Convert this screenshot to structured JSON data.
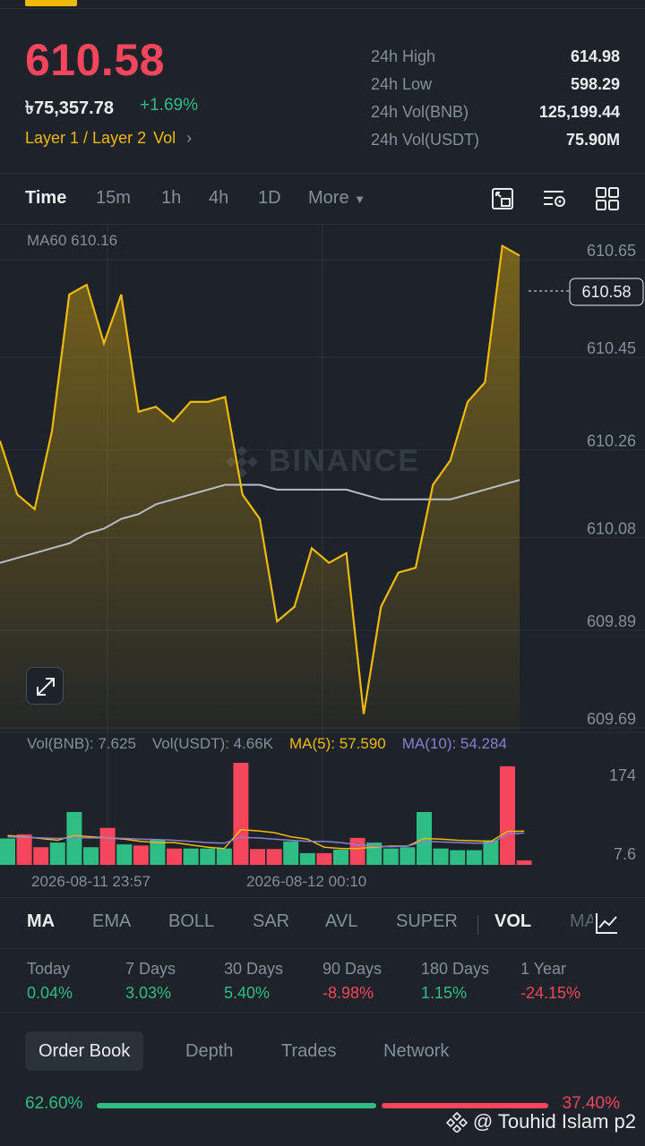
{
  "header": {
    "price": "610.58",
    "fiat_price": "৳75,357.78",
    "change_pct": "+1.69%",
    "tags": [
      "Layer 1 / Layer 2",
      "Vol"
    ],
    "tag_chevron": "›"
  },
  "stats": [
    {
      "label": "24h High",
      "value": "614.98"
    },
    {
      "label": "24h Low",
      "value": "598.29"
    },
    {
      "label": "24h Vol(BNB)",
      "value": "125,199.44"
    },
    {
      "label": "24h Vol(USDT)",
      "value": "75.90M"
    }
  ],
  "timebar": {
    "items": [
      "Time",
      "15m",
      "1h",
      "4h",
      "1D"
    ],
    "more_label": "More",
    "active": "Time",
    "icons": [
      "chart-settings-icon",
      "indicator-settings-icon",
      "grid-layout-icon"
    ]
  },
  "chart": {
    "ma60_label": "MA60 610.16",
    "watermark": "BINANCE",
    "current_price_tag": "610.58",
    "colors": {
      "line": "#f0b90b",
      "ma60": "#b7bdc6",
      "up": "#2ebd85",
      "down": "#f6465d",
      "ma5": "#f0b90b",
      "ma10": "#8a7dd3"
    }
  },
  "chart_data": [
    {
      "type": "area",
      "title": "",
      "series": [
        {
          "name": "",
          "values": [
            610.26,
            610.15,
            610.12,
            610.28,
            610.56,
            610.58,
            610.46,
            610.56,
            610.32,
            610.33,
            610.3,
            610.34,
            610.34,
            610.35,
            610.15,
            610.1,
            609.89,
            609.92,
            610.04,
            610.01,
            610.03,
            609.7,
            609.92,
            609.99,
            610.0,
            610.17,
            610.22,
            610.34,
            610.38,
            610.66,
            610.64
          ]
        },
        {
          "name": "MA60",
          "values": [
            610.01,
            610.02,
            610.03,
            610.04,
            610.05,
            610.07,
            610.08,
            610.1,
            610.11,
            610.13,
            610.14,
            610.15,
            610.16,
            610.17,
            610.17,
            610.17,
            610.16,
            610.16,
            610.16,
            610.16,
            610.16,
            610.15,
            610.14,
            610.14,
            610.14,
            610.14,
            610.14,
            610.15,
            610.16,
            610.17,
            610.18
          ]
        }
      ],
      "y_ticks": [
        "610.65",
        "610.45",
        "610.26",
        "610.08",
        "609.89",
        "609.69"
      ],
      "ylim": [
        609.69,
        610.65
      ]
    },
    {
      "type": "bar",
      "title": "",
      "legend": [
        "Vol(BNB): 7.625",
        "Vol(USDT): 4.66K",
        "MA(5): 57.590",
        "MA(10): 54.284"
      ],
      "series": [
        {
          "name": "Vol(BNB)",
          "values": [
            45,
            52,
            30,
            38,
            90,
            30,
            63,
            35,
            33,
            43,
            28,
            28,
            28,
            28,
            174,
            27,
            27,
            40,
            20,
            20,
            26,
            46,
            38,
            28,
            30,
            90,
            28,
            25,
            25,
            42,
            168,
            7.6
          ]
        },
        {
          "name": "MA(5)",
          "values": [
            50,
            48,
            45,
            42,
            50,
            48,
            46,
            44,
            40,
            38,
            38,
            34,
            30,
            28,
            60,
            58,
            55,
            48,
            44,
            30,
            28,
            28,
            30,
            32,
            32,
            45,
            44,
            42,
            41,
            40,
            57,
            57.59
          ]
        },
        {
          "name": "MA(10)",
          "values": [
            48,
            47,
            46,
            45,
            46,
            46,
            46,
            45,
            44,
            43,
            42,
            40,
            38,
            37,
            47,
            46,
            44,
            42,
            40,
            40,
            38,
            34,
            32,
            31,
            32,
            40,
            39,
            38,
            37,
            37,
            52,
            54.284
          ]
        }
      ],
      "colors_per_bar": [
        "up",
        "down",
        "down",
        "up",
        "up",
        "up",
        "down",
        "up",
        "down",
        "up",
        "down",
        "up",
        "up",
        "up",
        "down",
        "down",
        "down",
        "up",
        "up",
        "down",
        "up",
        "down",
        "up",
        "up",
        "up",
        "up",
        "up",
        "up",
        "up",
        "up",
        "down",
        "down"
      ],
      "y_ticks": [
        "174",
        "7.6"
      ],
      "x_labels": [
        "2026-08-11 23:57",
        "2026-08-12 00:10"
      ]
    }
  ],
  "indicators": {
    "items": [
      "MA",
      "EMA",
      "BOLL",
      "SAR",
      "AVL",
      "SUPER",
      "VOL",
      "MA"
    ],
    "active_main": "MA",
    "active_sub": "VOL"
  },
  "performance": [
    {
      "label": "Today",
      "value": "0.04%",
      "dir": "up"
    },
    {
      "label": "7 Days",
      "value": "3.03%",
      "dir": "up"
    },
    {
      "label": "30 Days",
      "value": "5.40%",
      "dir": "up"
    },
    {
      "label": "90 Days",
      "value": "-8.98%",
      "dir": "down"
    },
    {
      "label": "180 Days",
      "value": "1.15%",
      "dir": "up"
    },
    {
      "label": "1 Year",
      "value": "-24.15%",
      "dir": "down"
    }
  ],
  "book_tabs": [
    "Order Book",
    "Depth",
    "Trades",
    "Network"
  ],
  "ratio": {
    "buy": "62.60%",
    "sell": "37.40%",
    "buy_fraction": 0.626
  },
  "watermark_user": "@ Touhid Islam p2"
}
